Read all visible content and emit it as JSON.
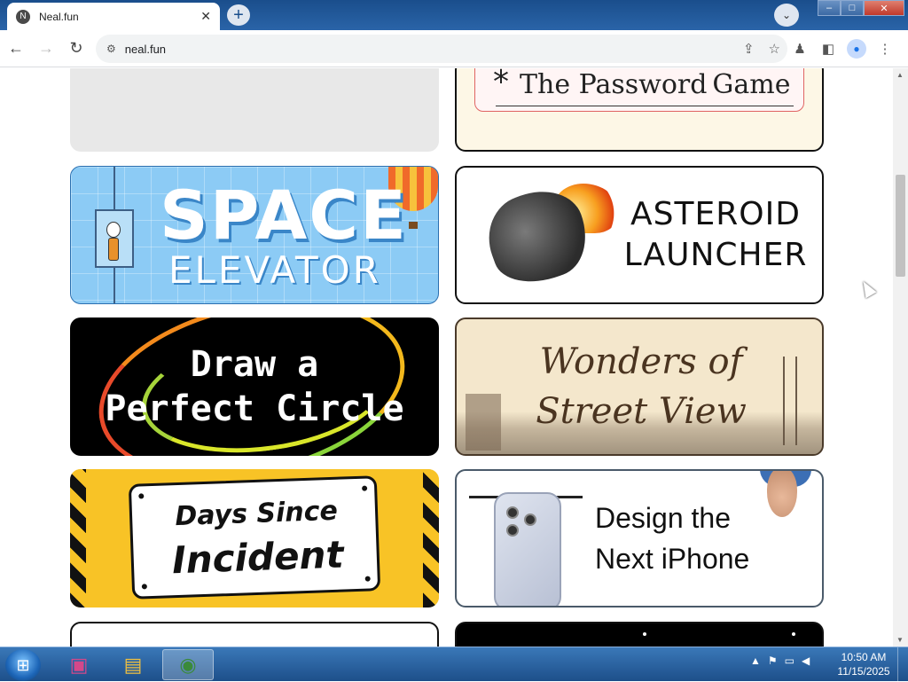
{
  "browser": {
    "tab_title": "Neal.fun",
    "tab_favicon": "N",
    "url": "neal.fun",
    "close_tab": "✕",
    "new_tab": "+",
    "tab_search": "⌄"
  },
  "toolbar": {
    "back": "←",
    "forward": "→",
    "reload": "↻",
    "site_info": "⚙",
    "share": "⇪",
    "bookmark": "☆",
    "extension": "♟",
    "sidepanel": "◧",
    "profile": "●",
    "menu": "⋮"
  },
  "cards": {
    "password": {
      "star": "*",
      "title": "The Password",
      "title2": "Game"
    },
    "space": {
      "line1": "SPACE",
      "line2": "ELEVATOR"
    },
    "asteroid": {
      "line1": "ASTEROID",
      "line2": "LAUNCHER"
    },
    "circle": {
      "line1": "Draw a",
      "line2": "Perfect Circle"
    },
    "wonders": {
      "line1": "Wonders of",
      "line2": "Street View"
    },
    "days": {
      "line1": "Days Since",
      "line2": "Incident"
    },
    "iphone": {
      "line1": "Design the",
      "line2": "Next iPhone"
    }
  },
  "taskbar": {
    "start_icon": "⊞",
    "items": [
      {
        "name": "app-icon",
        "glyph": "▣"
      },
      {
        "name": "file-explorer-icon",
        "glyph": "▤"
      },
      {
        "name": "chrome-icon",
        "glyph": "◉"
      }
    ],
    "time": "10:50 AM",
    "date": "11/15/2025",
    "tray_up": "▲",
    "tray_flag": "⚑",
    "tray_network": "▭",
    "tray_volume": "◀"
  },
  "colors": {
    "titlebar": "#1a4e8c",
    "accent": "#1a73e8",
    "days_yellow": "#f8c326",
    "wonders_bg": "#f4e7cc"
  }
}
